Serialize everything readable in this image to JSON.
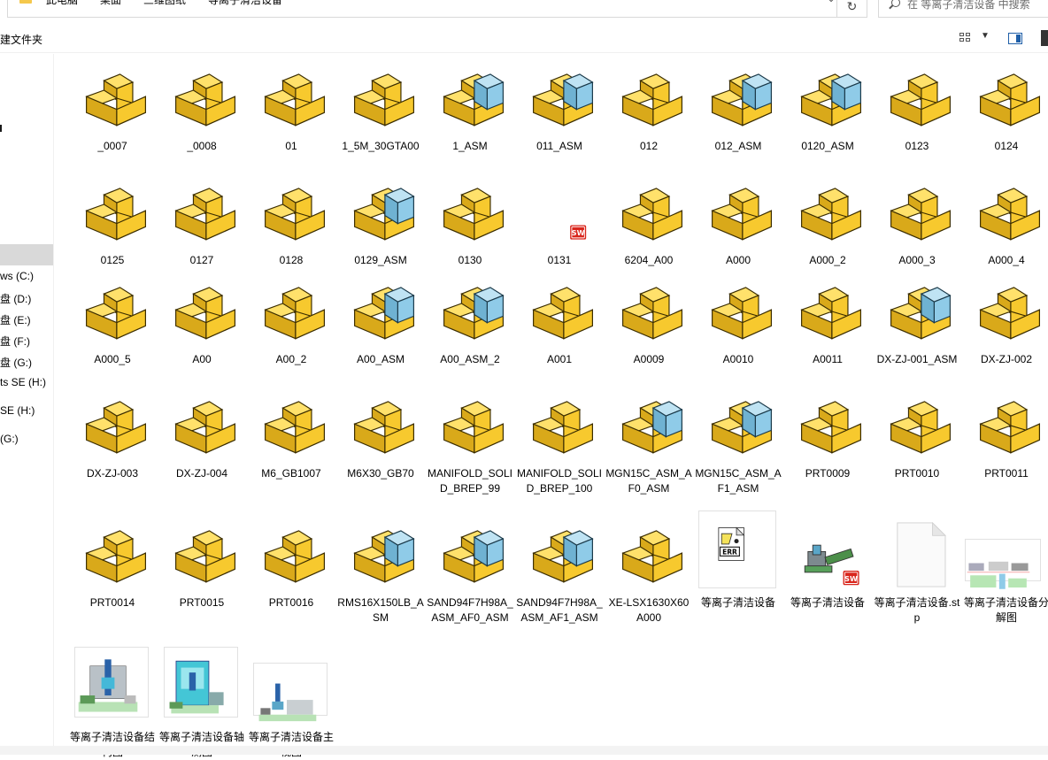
{
  "address_bar": {
    "breadcrumbs": [
      "此电脑",
      "桌面",
      "三维图纸",
      "等离子清洁设备"
    ]
  },
  "search": {
    "placeholder": "在 等离子清洁设备 中搜索"
  },
  "toolbar": {
    "new_folder_label": "建文件夹"
  },
  "navigation": {
    "items": [
      "ws (C:)",
      "盘 (D:)",
      "盘 (E:)",
      "盘 (F:)",
      "盘 (G:)",
      "ts SE (H:)",
      "SE (H:)",
      "(G:)"
    ]
  },
  "files": [
    {
      "name": "_0007",
      "icon": "part-icon"
    },
    {
      "name": "_0008",
      "icon": "part-icon"
    },
    {
      "name": "01",
      "icon": "part-icon"
    },
    {
      "name": "1_5M_30GTA00",
      "icon": "part-icon"
    },
    {
      "name": "1_ASM",
      "icon": "assembly-icon"
    },
    {
      "name": "011_ASM",
      "icon": "assembly-icon"
    },
    {
      "name": "012",
      "icon": "part-icon"
    },
    {
      "name": "012_ASM",
      "icon": "assembly-icon"
    },
    {
      "name": "0120_ASM",
      "icon": "assembly-icon"
    },
    {
      "name": "0123",
      "icon": "part-icon"
    },
    {
      "name": "0124",
      "icon": "part-icon"
    },
    {
      "name": "0125",
      "icon": "part-icon"
    },
    {
      "name": "0127",
      "icon": "part-icon"
    },
    {
      "name": "0128",
      "icon": "part-icon"
    },
    {
      "name": "0129_ASM",
      "icon": "assembly-icon"
    },
    {
      "name": "0130",
      "icon": "part-icon"
    },
    {
      "name": "0131",
      "icon": "solidworks-icon"
    },
    {
      "name": "6204_A00",
      "icon": "part-icon"
    },
    {
      "name": "A000",
      "icon": "part-icon"
    },
    {
      "name": "A000_2",
      "icon": "part-icon"
    },
    {
      "name": "A000_3",
      "icon": "part-icon"
    },
    {
      "name": "A000_4",
      "icon": "part-icon"
    },
    {
      "name": "A000_5",
      "icon": "part-icon"
    },
    {
      "name": "A00",
      "icon": "part-icon"
    },
    {
      "name": "A00_2",
      "icon": "part-icon"
    },
    {
      "name": "A00_ASM",
      "icon": "assembly-icon"
    },
    {
      "name": "A00_ASM_2",
      "icon": "assembly-icon"
    },
    {
      "name": "A001",
      "icon": "part-icon"
    },
    {
      "name": "A0009",
      "icon": "part-icon"
    },
    {
      "name": "A0010",
      "icon": "part-icon"
    },
    {
      "name": "A0011",
      "icon": "part-icon"
    },
    {
      "name": "DX-ZJ-001_ASM",
      "icon": "assembly-icon"
    },
    {
      "name": "DX-ZJ-002",
      "icon": "part-icon"
    },
    {
      "name": "DX-ZJ-003",
      "icon": "part-icon"
    },
    {
      "name": "DX-ZJ-004",
      "icon": "part-icon"
    },
    {
      "name": "M6_GB1007",
      "icon": "part-icon"
    },
    {
      "name": "M6X30_GB70",
      "icon": "part-icon"
    },
    {
      "name": "MANIFOLD_SOLID_BREP_99",
      "icon": "part-icon"
    },
    {
      "name": "MANIFOLD_SOLID_BREP_100",
      "icon": "part-icon"
    },
    {
      "name": "MGN15C_ASM_AF0_ASM",
      "icon": "assembly-icon"
    },
    {
      "name": "MGN15C_ASM_AF1_ASM",
      "icon": "assembly-icon"
    },
    {
      "name": "PRT0009",
      "icon": "part-icon"
    },
    {
      "name": "PRT0010",
      "icon": "part-icon"
    },
    {
      "name": "PRT0011",
      "icon": "part-icon"
    },
    {
      "name": "PRT0014",
      "icon": "part-icon"
    },
    {
      "name": "PRT0015",
      "icon": "part-icon"
    },
    {
      "name": "PRT0016",
      "icon": "part-icon"
    },
    {
      "name": "RMS16X150LB_ASM",
      "icon": "assembly-icon"
    },
    {
      "name": "SAND94F7H98A_ASM_AF0_ASM",
      "icon": "assembly-icon"
    },
    {
      "name": "SAND94F7H98A_ASM_AF1_ASM",
      "icon": "assembly-icon"
    },
    {
      "name": "XE-LSX1630X60A000",
      "icon": "part-icon"
    },
    {
      "name": "等离子清洁设备",
      "icon": "error-file-icon"
    },
    {
      "name": "等离子清洁设备",
      "icon": "solidworks-assembly-icon"
    },
    {
      "name": "等离子清洁设备.stp",
      "icon": "blank-file-icon"
    },
    {
      "name": "等离子清洁设备分解图",
      "icon": "drawing-thumbnail-icon"
    },
    {
      "name": "等离子清洁设备结构图",
      "icon": "machine-thumbnail-icon"
    },
    {
      "name": "等离子清洁设备轴测图",
      "icon": "machine-iso-thumbnail-icon"
    },
    {
      "name": "等离子清洁设备主视图",
      "icon": "machine-front-thumbnail-icon"
    }
  ],
  "colors": {
    "part_yellow": "#f7c92e",
    "part_shade": "#d9a91a",
    "asm_blue": "#8fcbe8",
    "selection": "#d9d9d9",
    "solidworks_red": "#d9261c"
  }
}
